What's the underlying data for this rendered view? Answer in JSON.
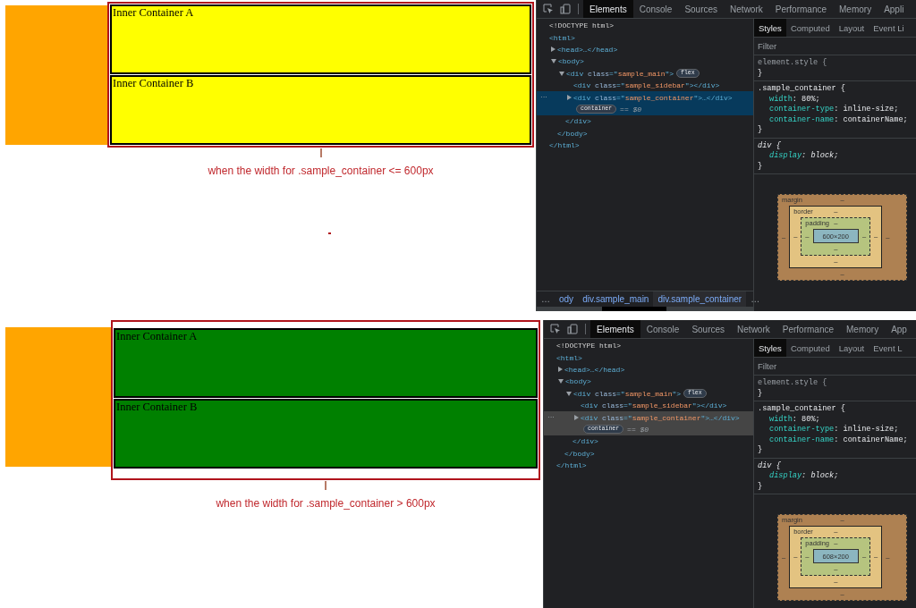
{
  "panels": [
    {
      "page": {
        "color": "#ffff00",
        "inner_containers": [
          "Inner Container A",
          "Inner Container B"
        ]
      },
      "caption": "when the width for .sample_container <= 600px",
      "stray_dot": true,
      "devtools": {
        "selection_focused": true,
        "tabs": [
          {
            "label": "Elements",
            "selected": true
          },
          {
            "label": "Console",
            "selected": false
          },
          {
            "label": "Sources",
            "selected": false
          },
          {
            "label": "Network",
            "selected": false
          },
          {
            "label": "Performance",
            "selected": false
          },
          {
            "label": "Memory",
            "selected": false
          },
          {
            "label": "Appli",
            "selected": false
          }
        ],
        "dom": [
          {
            "selected": false,
            "parts": [
              {
                "kind": "plain",
                "text": "<!DOCTYPE html>"
              }
            ]
          },
          {
            "selected": false,
            "parts": [
              {
                "kind": "tag",
                "text": "<html>"
              }
            ],
            "closing": "</html>",
            "children": [
              {
                "selected": false,
                "expanded": false,
                "parts": [
                  {
                    "kind": "tag",
                    "text": "<head>…</head>"
                  }
                ]
              },
              {
                "selected": false,
                "expanded": true,
                "parts": [
                  {
                    "kind": "tag",
                    "text": "<body>"
                  }
                ],
                "closing": "</body>",
                "children": [
                  {
                    "selected": false,
                    "expanded": true,
                    "badge": "flex",
                    "parts": [
                      {
                        "kind": "tag",
                        "text": "<div "
                      },
                      {
                        "kind": "attr",
                        "text": "class"
                      },
                      {
                        "kind": "tag",
                        "text": "=\""
                      },
                      {
                        "kind": "value",
                        "text": "sample_main"
                      },
                      {
                        "kind": "tag",
                        "text": "\">"
                      }
                    ],
                    "closing": "</div>",
                    "children": [
                      {
                        "selected": false,
                        "parts": [
                          {
                            "kind": "tag",
                            "text": "<div "
                          },
                          {
                            "kind": "attr",
                            "text": "class"
                          },
                          {
                            "kind": "tag",
                            "text": "=\""
                          },
                          {
                            "kind": "value",
                            "text": "sample_sidebar"
                          },
                          {
                            "kind": "tag",
                            "text": "\"></div>"
                          }
                        ]
                      },
                      {
                        "selected": true,
                        "expanded": false,
                        "gutter": "···",
                        "parts": [
                          {
                            "kind": "tag",
                            "text": "<div "
                          },
                          {
                            "kind": "attr",
                            "text": "class"
                          },
                          {
                            "kind": "tag",
                            "text": "=\""
                          },
                          {
                            "kind": "value",
                            "text": "sample_container"
                          },
                          {
                            "kind": "tag",
                            "text": "\">…</div>"
                          }
                        ],
                        "line_badge": "container",
                        "line_suffix": "== $0"
                      }
                    ]
                  }
                ]
              }
            ]
          }
        ],
        "breadcrumbs": [
          {
            "label": "…",
            "selected": false
          },
          {
            "label": "ody",
            "selected": false
          },
          {
            "label": "div.sample_main",
            "selected": false
          },
          {
            "label": "div.sample_container",
            "selected": true
          },
          {
            "label": "…",
            "selected": false
          }
        ],
        "styles_tabs": [
          {
            "label": "Styles",
            "selected": true
          },
          {
            "label": "Computed",
            "selected": false
          },
          {
            "label": "Layout",
            "selected": false
          },
          {
            "label": "Event Li",
            "selected": false
          }
        ],
        "filter_placeholder": "Filter",
        "rules": [
          {
            "kind": "inline",
            "selector": "element.style {",
            "close": "}"
          },
          {
            "kind": "author",
            "selector": ".sample_container {",
            "declarations": [
              {
                "property": "width",
                "value": ": 80%;"
              },
              {
                "property": "container-type",
                "value": ": inline-size;"
              },
              {
                "property": "container-name",
                "value": ": containerName;"
              }
            ],
            "close": "}"
          },
          {
            "kind": "user-agent",
            "selector": "div {",
            "declarations": [
              {
                "property": "display",
                "value": ": block;"
              }
            ],
            "close": "}"
          }
        ],
        "box_model": {
          "margin": {
            "label": "margin",
            "top": "–",
            "right": "–",
            "bottom": "–",
            "left": "–"
          },
          "border": {
            "label": "border",
            "top": "–",
            "right": "–",
            "bottom": "–",
            "left": "–"
          },
          "padding": {
            "label": "padding",
            "top": "–",
            "right": "–",
            "bottom": "–",
            "left": "–"
          },
          "content": "600×200"
        }
      }
    },
    {
      "page": {
        "color": "#008000",
        "inner_containers": [
          "Inner Container A",
          "Inner Container B"
        ]
      },
      "caption": "when the width for .sample_container > 600px",
      "devtools": {
        "selection_focused": false,
        "tabs": [
          {
            "label": "Elements",
            "selected": true
          },
          {
            "label": "Console",
            "selected": false
          },
          {
            "label": "Sources",
            "selected": false
          },
          {
            "label": "Network",
            "selected": false
          },
          {
            "label": "Performance",
            "selected": false
          },
          {
            "label": "Memory",
            "selected": false
          },
          {
            "label": "App",
            "selected": false
          }
        ],
        "dom": [
          {
            "selected": false,
            "parts": [
              {
                "kind": "plain",
                "text": "<!DOCTYPE html>"
              }
            ]
          },
          {
            "selected": false,
            "parts": [
              {
                "kind": "tag",
                "text": "<html>"
              }
            ],
            "closing": "</html>",
            "children": [
              {
                "selected": false,
                "expanded": false,
                "parts": [
                  {
                    "kind": "tag",
                    "text": "<head>…</head>"
                  }
                ]
              },
              {
                "selected": false,
                "expanded": true,
                "parts": [
                  {
                    "kind": "tag",
                    "text": "<body>"
                  }
                ],
                "closing": "</body>",
                "children": [
                  {
                    "selected": false,
                    "expanded": true,
                    "badge": "flex",
                    "parts": [
                      {
                        "kind": "tag",
                        "text": "<div "
                      },
                      {
                        "kind": "attr",
                        "text": "class"
                      },
                      {
                        "kind": "tag",
                        "text": "=\""
                      },
                      {
                        "kind": "value",
                        "text": "sample_main"
                      },
                      {
                        "kind": "tag",
                        "text": "\">"
                      }
                    ],
                    "closing": "</div>",
                    "children": [
                      {
                        "selected": false,
                        "parts": [
                          {
                            "kind": "tag",
                            "text": "<div "
                          },
                          {
                            "kind": "attr",
                            "text": "class"
                          },
                          {
                            "kind": "tag",
                            "text": "=\""
                          },
                          {
                            "kind": "value",
                            "text": "sample_sidebar"
                          },
                          {
                            "kind": "tag",
                            "text": "\"></div>"
                          }
                        ]
                      },
                      {
                        "selected": true,
                        "expanded": false,
                        "gutter": "···",
                        "parts": [
                          {
                            "kind": "tag",
                            "text": "<div "
                          },
                          {
                            "kind": "attr",
                            "text": "class"
                          },
                          {
                            "kind": "tag",
                            "text": "=\""
                          },
                          {
                            "kind": "value",
                            "text": "sample_container"
                          },
                          {
                            "kind": "tag",
                            "text": "\">…</div>"
                          }
                        ],
                        "line_badge": "container",
                        "line_suffix": "== $0"
                      }
                    ]
                  }
                ]
              }
            ]
          }
        ],
        "styles_tabs": [
          {
            "label": "Styles",
            "selected": true
          },
          {
            "label": "Computed",
            "selected": false
          },
          {
            "label": "Layout",
            "selected": false
          },
          {
            "label": "Event L",
            "selected": false
          }
        ],
        "filter_placeholder": "Filter",
        "rules": [
          {
            "kind": "inline",
            "selector": "element.style {",
            "close": "}"
          },
          {
            "kind": "author",
            "selector": ".sample_container {",
            "declarations": [
              {
                "property": "width",
                "value": ": 80%;"
              },
              {
                "property": "container-type",
                "value": ": inline-size;"
              },
              {
                "property": "container-name",
                "value": ": containerName;"
              }
            ],
            "close": "}"
          },
          {
            "kind": "user-agent",
            "selector": "div {",
            "declarations": [
              {
                "property": "display",
                "value": ": block;"
              }
            ],
            "close": "}"
          }
        ],
        "box_model": {
          "margin": {
            "label": "margin",
            "top": "–",
            "right": "–",
            "bottom": "–",
            "left": "–"
          },
          "border": {
            "label": "border",
            "top": "–",
            "right": "–",
            "bottom": "–",
            "left": "–"
          },
          "padding": {
            "label": "padding",
            "top": "–",
            "right": "–",
            "bottom": "–",
            "left": "–"
          },
          "content": "608×200"
        }
      }
    }
  ]
}
